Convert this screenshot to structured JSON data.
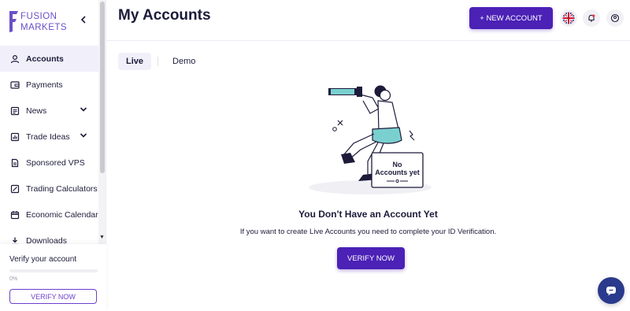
{
  "brand": {
    "line1": "FUSION",
    "line2": "MARKETS",
    "accent": "#4b21b6"
  },
  "sidebar": {
    "items": [
      {
        "label": "Accounts",
        "icon": "user-icon",
        "active": true
      },
      {
        "label": "Payments",
        "icon": "wallet-icon"
      },
      {
        "label": "News",
        "icon": "newspaper-icon",
        "expandable": true
      },
      {
        "label": "Trade Ideas",
        "icon": "chart-icon",
        "expandable": true
      },
      {
        "label": "Sponsored VPS",
        "icon": "document-icon"
      },
      {
        "label": "Trading Calculators",
        "icon": "calculator-icon"
      },
      {
        "label": "Economic Calendar",
        "icon": "calendar-icon"
      },
      {
        "label": "Downloads",
        "icon": "download-icon"
      }
    ],
    "verify": {
      "title": "Verify your account",
      "progress_text": "0%",
      "progress": 0,
      "button": "VERIFY NOW"
    }
  },
  "header": {
    "title": "My Accounts",
    "new_account": "+ NEW ACCOUNT"
  },
  "tabs": [
    {
      "label": "Live",
      "active": true
    },
    {
      "label": "Demo"
    }
  ],
  "empty_state": {
    "illustration_text_line1": "No",
    "illustration_text_line2": "Accounts yet",
    "title": "You Don't Have an Account Yet",
    "subtitle": "If you want to create Live Accounts you need to complete your ID Verification.",
    "button": "VERIFY NOW"
  }
}
